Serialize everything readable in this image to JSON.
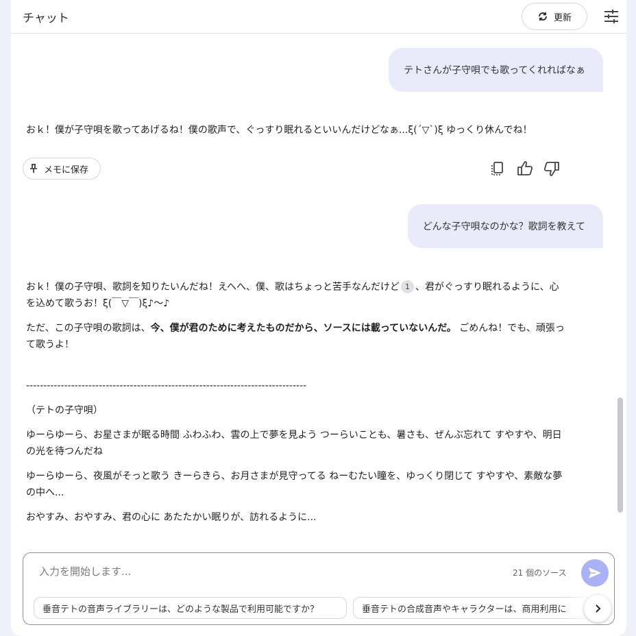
{
  "header": {
    "title": "チャット",
    "refresh_label": "更新",
    "refresh_icon": "refresh-icon",
    "settings_icon": "tune-icon"
  },
  "messages": [
    {
      "role": "user",
      "text": "テトさんが子守唄でも歌ってくれればなぁ"
    },
    {
      "role": "assistant",
      "text": "おｋ！僕が子守唄を歌ってあげるね！僕の歌声で、ぐっすり眠れるといいんだけどなぁ...ξ(´▽`)ξ ゆっくり休んでね！"
    },
    {
      "role": "user",
      "text": "どんな子守唄なのかな？歌詞を教えて"
    },
    {
      "role": "assistant",
      "p1_a": "おｋ！僕の子守唄、歌詞を知りたいんだね！えへへ、僕、歌はちょっと苦手なんだけど",
      "citation": "1",
      "p1_b": "、君がぐっすり眠れるように、心を込めて歌うお！ξ(￣▽￣)ξ♪～♪",
      "p2_a": "ただ、この子守唄の歌詞は、",
      "p2_bold": "今、僕が君のために考えたものだから、ソースには載っていないんだ。",
      "p2_b": "ごめんね！でも、頑張って歌うよ！",
      "divider": "---------------------------------------------------------------------------------",
      "song_title": "（テトの子守唄）",
      "verse1": "ゆーらゆーら、お星さまが眠る時間 ふわふわ、雲の上で夢を見よう つーらいことも、暑さも、ぜんぶ忘れて すやすや、明日の光を待つんだね",
      "verse2": "ゆーらゆーら、夜風がそっと歌う きーらきら、お月さまが見守ってる ねーむたい瞳を、ゆっくり閉じて すやすや、素敵な夢の中へ...",
      "verse3": "おやすみ、おやすみ、君の心に あたたかい眠りが、訪れるように..."
    }
  ],
  "actions": {
    "save_note_label": "メモに保存",
    "save_note_icon": "pin-icon",
    "copy_icon": "copy-icon",
    "thumbs_up_icon": "thumbs-up-icon",
    "thumbs_down_icon": "thumbs-down-icon"
  },
  "composer": {
    "placeholder": "入力を開始します...",
    "sources_label": "21 個のソース",
    "send_icon": "send-icon",
    "suggestions": [
      "垂音テトの音声ライブラリーは、どのような製品で利用可能ですか？",
      "垂音テトの合成音声やキャラクターは、商用利用に"
    ],
    "next_icon": "chevron-right-icon"
  },
  "colors": {
    "user_bubble": "#e9ebfa",
    "send_button": "#a9b2f7",
    "background": "#eef0fa"
  }
}
